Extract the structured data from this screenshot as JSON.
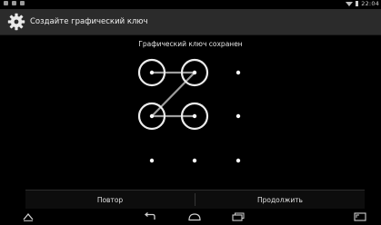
{
  "status_bar": {
    "time": "22:04",
    "icons": [
      "notification-icon",
      "usb-icon",
      "image-icon",
      "wifi-icon",
      "battery-icon"
    ]
  },
  "action_bar": {
    "title": "Создайте графический ключ",
    "icon": "settings-gear-icon"
  },
  "pattern_screen": {
    "header_message": "Графический ключ сохранен",
    "grid": {
      "rows": 3,
      "cols": 3,
      "selected_sequence": [
        1,
        2,
        4,
        5
      ]
    }
  },
  "footer": {
    "retry_label": "Повтор",
    "continue_label": "Продолжить"
  },
  "nav_bar": {
    "icons": [
      "home-up-icon",
      "back-icon",
      "home-icon",
      "recent-apps-icon",
      "screenshot-icon"
    ]
  },
  "colors": {
    "background": "#000000",
    "action_bar": "#2b2b2b",
    "pattern_line": "#9e9e9e",
    "text": "#e8e8e8"
  }
}
